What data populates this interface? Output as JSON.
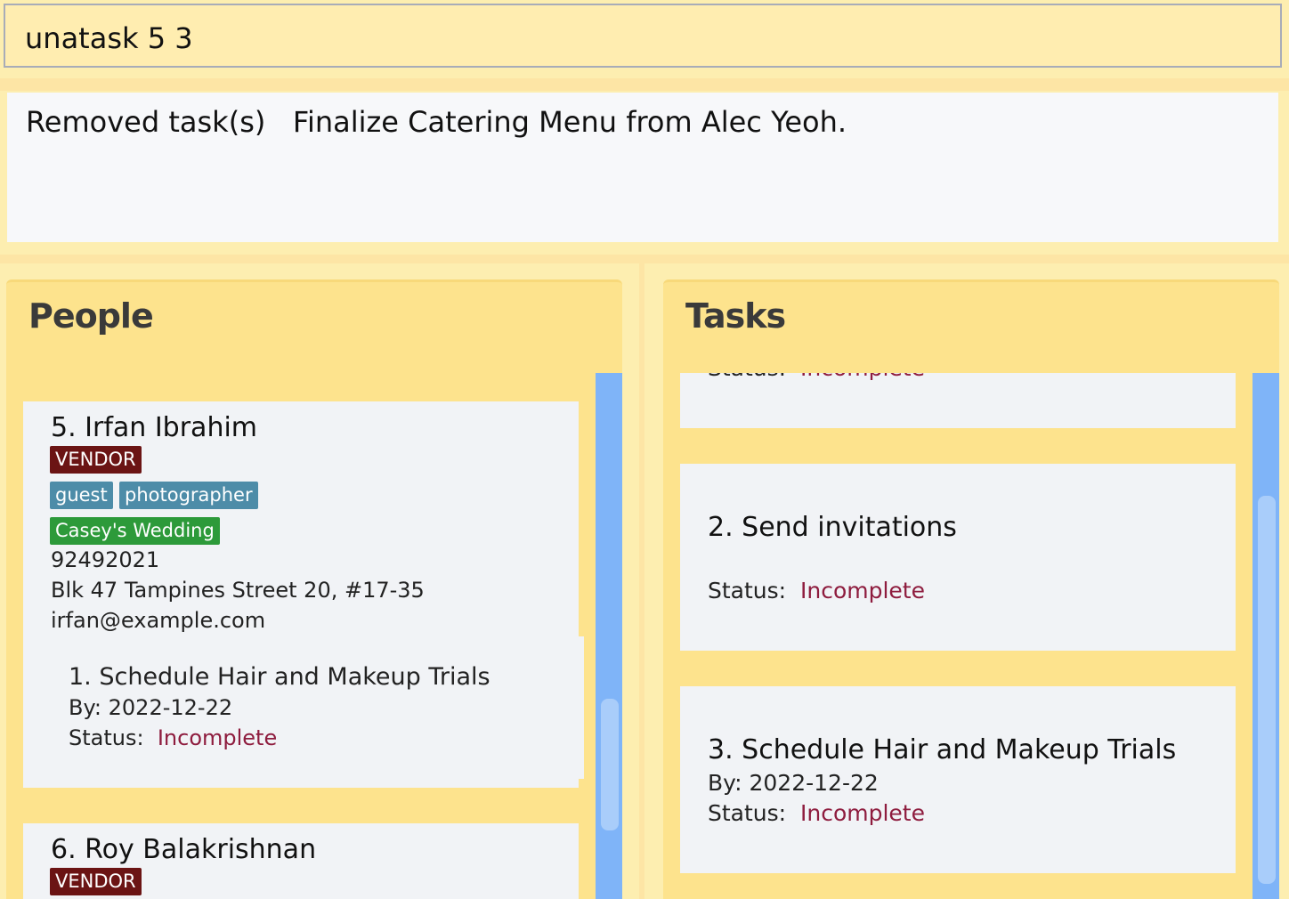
{
  "command": {
    "value": "unatask 5 3"
  },
  "result": {
    "text": "Removed task(s)   Finalize Catering Menu from Alec Yeoh."
  },
  "people_panel": {
    "title": "People",
    "persons": [
      {
        "name": "5. Irfan Ibrahim",
        "type_tag": "VENDOR",
        "tags": [
          "guest",
          "photographer"
        ],
        "wedding_tag": "Casey's Wedding",
        "phone": "92492021",
        "address": "Blk 47 Tampines Street 20, #17-35",
        "email": "irfan@example.com",
        "tasks": [
          {
            "title": "1.  Schedule Hair and Makeup Trials",
            "by": "By: 2022-12-22",
            "status_label": "Status:",
            "status_value": "Incomplete"
          }
        ]
      },
      {
        "name": "6. Roy Balakrishnan",
        "type_tag": "VENDOR"
      }
    ]
  },
  "tasks_panel": {
    "title": "Tasks",
    "tasks": [
      {
        "status_label": "Status:",
        "status_value": "Incomplete"
      },
      {
        "title": "2. Send invitations",
        "status_label": "Status:",
        "status_value": "Incomplete"
      },
      {
        "title": "3. Schedule Hair and Makeup Trials",
        "by": "By: 2022-12-22",
        "status_label": "Status:",
        "status_value": "Incomplete"
      }
    ]
  },
  "colors": {
    "background": "#fdeeb0",
    "panel": "#fde38d",
    "vendor_tag": "#6b1414",
    "role_tag": "#4d8ca8",
    "wedding_tag": "#2d9a3a",
    "status_incomplete": "#8e1c3e",
    "scrollbar": "#7fb4f8"
  }
}
